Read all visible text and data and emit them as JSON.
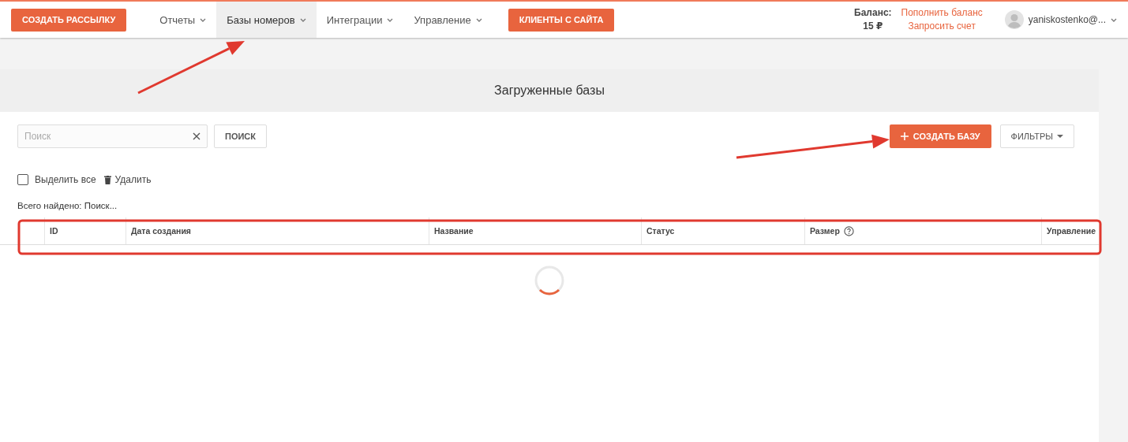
{
  "top_bar": {
    "create_button": "СОЗДАТЬ РАССЫЛКУ",
    "nav": [
      {
        "label": "Отчеты",
        "selected": false
      },
      {
        "label": "Базы номеров",
        "selected": true
      },
      {
        "label": "Интеграции",
        "selected": false
      },
      {
        "label": "Управление",
        "selected": false
      }
    ],
    "site_clients_button": "КЛИЕНТЫ С САЙТА",
    "balance": {
      "label": "Баланс:",
      "amount": "15 ₽"
    },
    "links": [
      "Пополнить баланс",
      "Запросить счет"
    ],
    "user": {
      "name": "yaniskostenko@..."
    }
  },
  "page": {
    "title": "Загруженные базы",
    "search": {
      "placeholder": "Поиск",
      "button": "ПОИСК"
    },
    "create_base_button": "СОЗДАТЬ БАЗУ",
    "filters_button": "ФИЛЬТРЫ",
    "select_all": {
      "label": "Выделить все",
      "checked": false
    },
    "delete_button": "Удалить",
    "total": "Всего найдено: Поиск...",
    "table": {
      "columns": [
        "ID",
        "Дата создания",
        "Название",
        "Статус",
        "Размер",
        "Управление"
      ]
    },
    "loading": true
  },
  "annotations": [
    {
      "kind": "arrow"
    },
    {
      "kind": "arrow"
    },
    {
      "kind": "frame"
    }
  ]
}
